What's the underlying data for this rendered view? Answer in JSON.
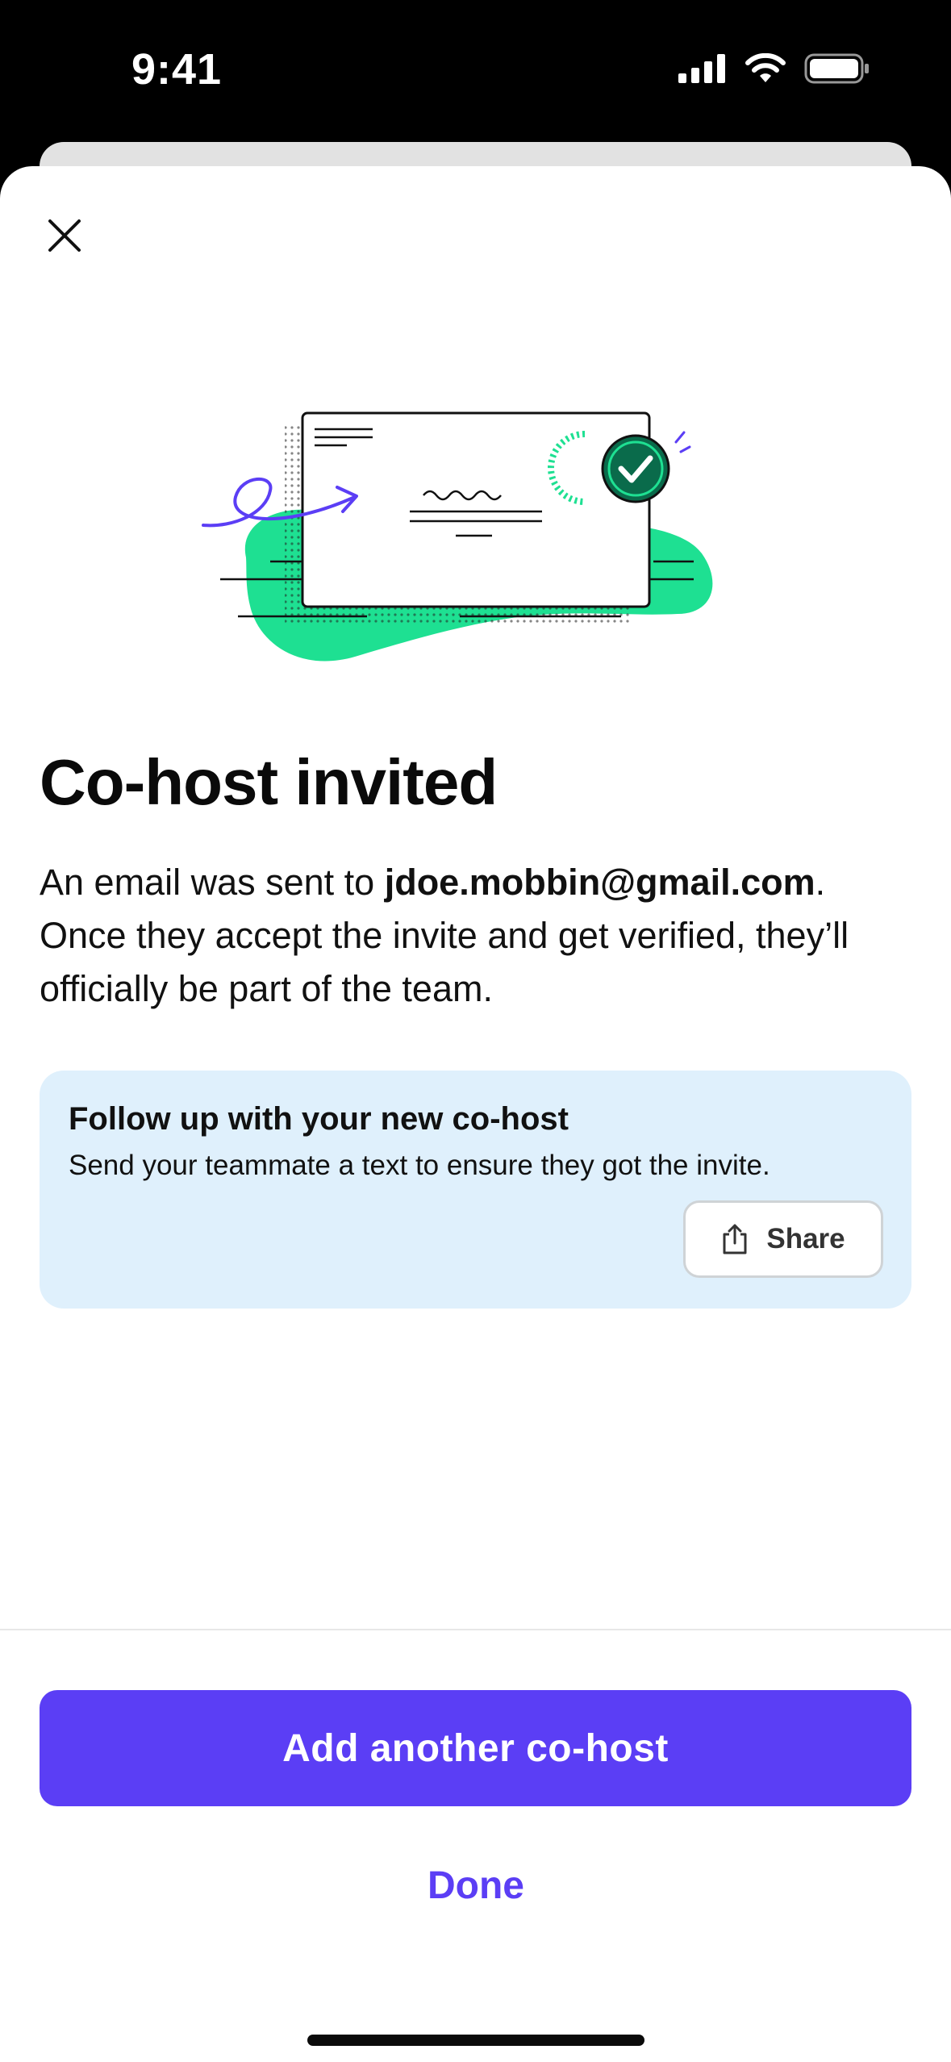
{
  "status_bar": {
    "time": "9:41",
    "icons": [
      "signal-icon",
      "wifi-icon",
      "battery-icon"
    ]
  },
  "sheet": {
    "close_icon": "close-icon",
    "illustration": "envelope-checkmark-illustration",
    "title": "Co-host invited",
    "body": {
      "prefix": "An email was sent to ",
      "email": "jdoe.mobbin@gmail.com",
      "suffix": ". Once they accept the invite and get verified, they’ll officially be part of the team."
    },
    "card": {
      "title": "Follow up with your new co-host",
      "text": "Send your teammate a text to ensure they got the invite.",
      "share_label": "Share",
      "share_icon": "share-icon"
    },
    "footer": {
      "primary_label": "Add another co-host",
      "secondary_label": "Done"
    }
  },
  "colors": {
    "accent": "#5b3ef5",
    "card_bg": "#dff0fc",
    "blob_green": "#1ee092",
    "check_green": "#0a6b4b"
  }
}
